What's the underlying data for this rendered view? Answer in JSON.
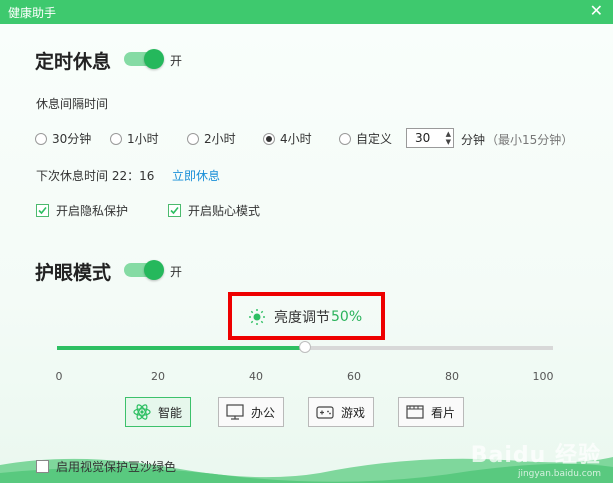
{
  "window": {
    "title": "健康助手",
    "close_glyph": "✕"
  },
  "rest": {
    "title": "定时休息",
    "toggle_label": "开",
    "toggle_on": true,
    "interval_label": "休息间隔时间",
    "options": [
      {
        "label": "30分钟",
        "selected": false
      },
      {
        "label": "1小时",
        "selected": false
      },
      {
        "label": "2小时",
        "selected": false
      },
      {
        "label": "4小时",
        "selected": true
      },
      {
        "label": "自定义",
        "selected": false
      }
    ],
    "custom_value": "30",
    "custom_unit": "分钟",
    "custom_hint": "（最小15分钟）",
    "next_rest": "下次休息时间 22：16",
    "rest_now": "立即休息",
    "privacy_label": "开启隐私保护",
    "privacy_checked": true,
    "care_label": "开启贴心模式",
    "care_checked": true
  },
  "eye": {
    "title": "护眼模式",
    "toggle_label": "开",
    "toggle_on": true,
    "brightness_label": "亮度调节",
    "brightness_value": "50%",
    "brightness_fraction": 0.5,
    "ticks": [
      "0",
      "20",
      "40",
      "60",
      "80",
      "100"
    ],
    "modes": [
      {
        "label": "智能",
        "icon": "smart-icon",
        "active": true
      },
      {
        "label": "办公",
        "icon": "monitor-icon",
        "active": false
      },
      {
        "label": "游戏",
        "icon": "gamepad-icon",
        "active": false
      },
      {
        "label": "看片",
        "icon": "film-icon",
        "active": false
      }
    ],
    "green_bg_label": "启用视觉保护豆沙绿色",
    "green_bg_checked": false
  },
  "colors": {
    "accent": "#2dbf62",
    "titlebar": "#3ec96e",
    "highlight": "#e00000"
  },
  "watermark": {
    "brand": "Baidu 经验",
    "url": "jingyan.baidu.com"
  }
}
